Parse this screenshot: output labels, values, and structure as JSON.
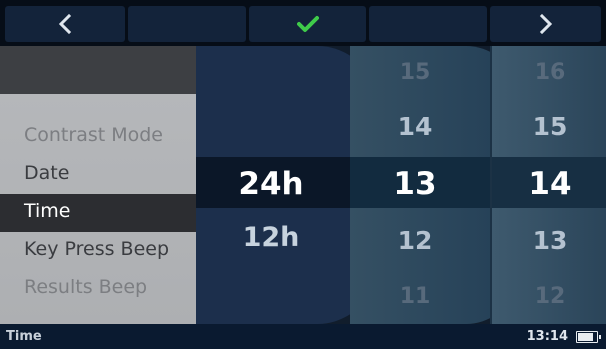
{
  "toolbar": {
    "left_icon": "chevron-left-icon",
    "confirm_icon": "checkmark-icon",
    "right_icon": "chevron-right-icon",
    "confirm_color": "#3fcb4a"
  },
  "menu": {
    "items": [
      {
        "label": "Contrast Mode",
        "state": "dim"
      },
      {
        "label": "Date",
        "state": "normal"
      },
      {
        "label": "Time",
        "state": "selected"
      },
      {
        "label": "Key Press Beep",
        "state": "normal"
      },
      {
        "label": "Results Beep",
        "state": "dim"
      }
    ]
  },
  "pickers": {
    "format": {
      "options": [
        "24h",
        "12h"
      ],
      "selected": "24h"
    },
    "hour": {
      "above_far": "15",
      "above": "14",
      "selected": "13",
      "below": "12",
      "below_far": "11"
    },
    "minute": {
      "above_far": "16",
      "above": "15",
      "selected": "14",
      "below": "13",
      "below_far": "12"
    }
  },
  "status": {
    "title": "Time",
    "clock": "13:14",
    "battery_level": 0.85
  }
}
